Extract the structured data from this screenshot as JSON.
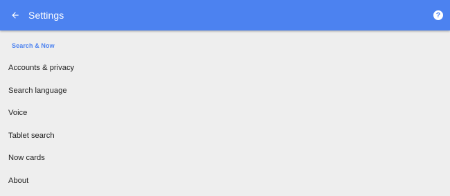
{
  "header": {
    "title": "Settings",
    "back_icon": "arrow-back-icon",
    "help_icon": "help-icon",
    "help_glyph": "?"
  },
  "section": {
    "title": "Search & Now"
  },
  "items": [
    {
      "label": "Accounts & privacy"
    },
    {
      "label": "Search language"
    },
    {
      "label": "Voice"
    },
    {
      "label": "Tablet search"
    },
    {
      "label": "Now cards"
    },
    {
      "label": "About"
    }
  ],
  "colors": {
    "app_bar": "#4c82f0",
    "accent": "#4c82f0",
    "background": "#eeeeee",
    "text_primary": "#212121"
  }
}
